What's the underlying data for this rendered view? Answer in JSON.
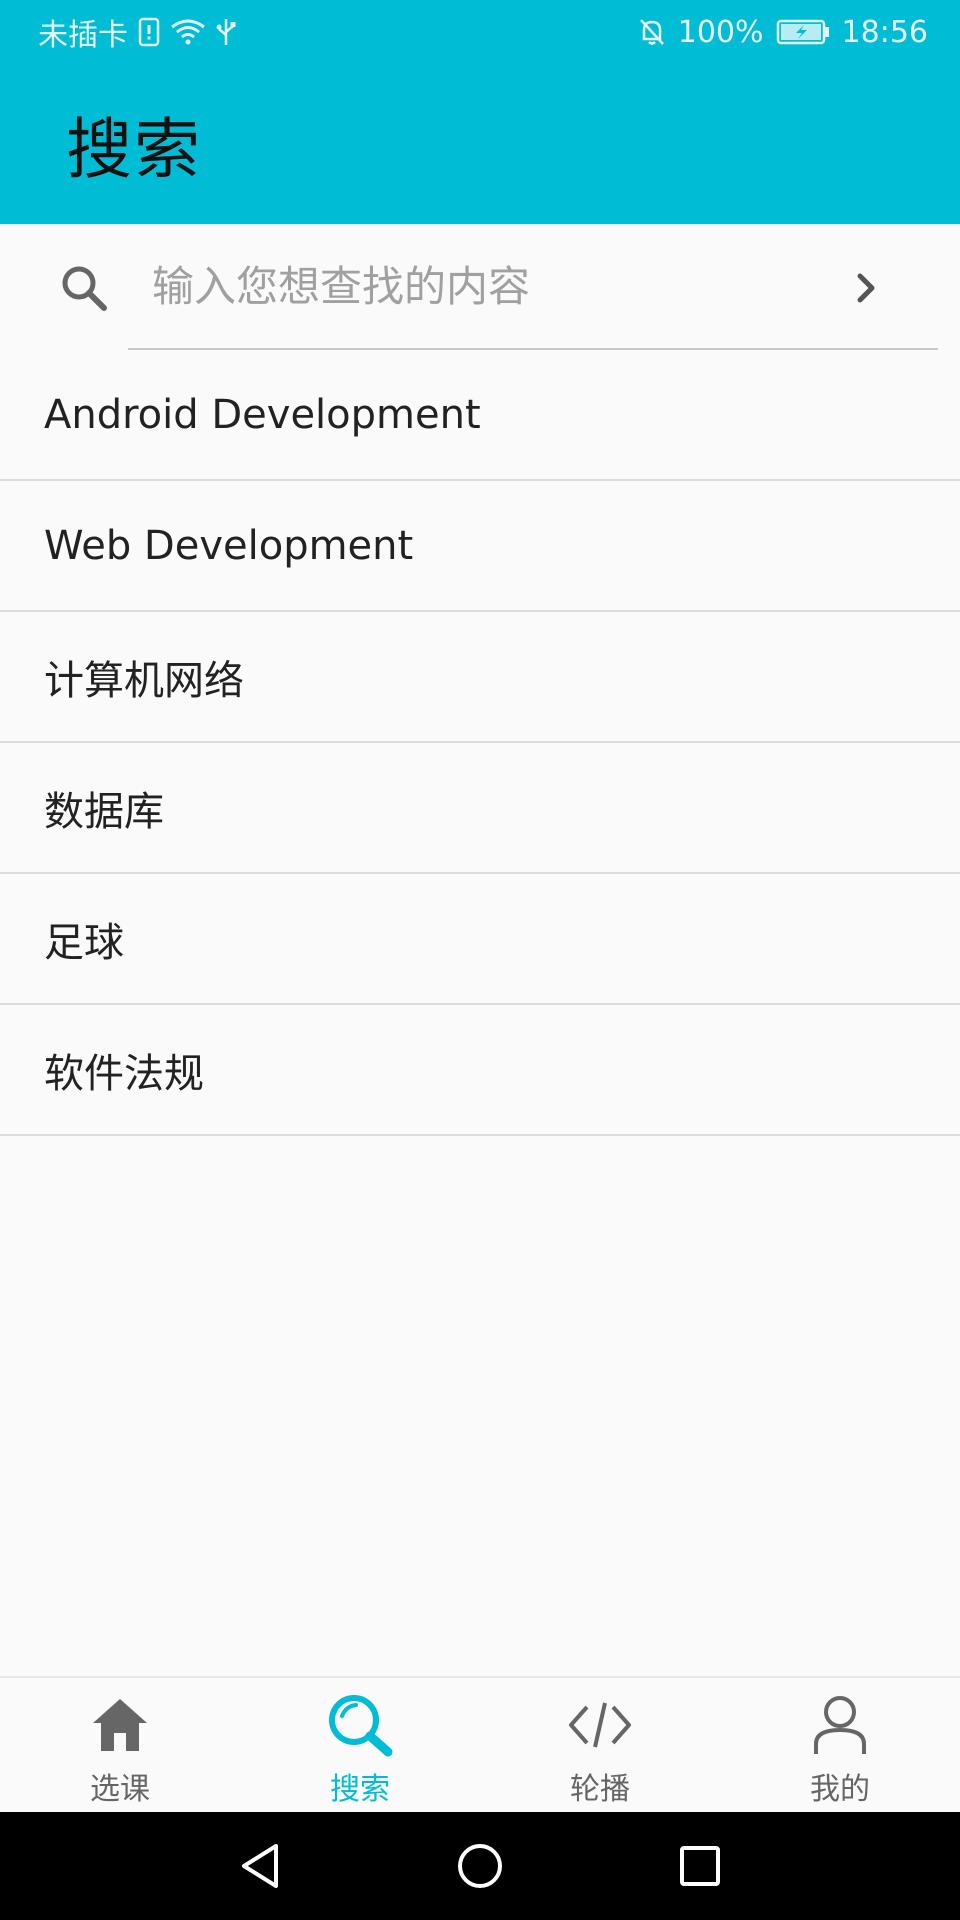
{
  "status_bar": {
    "carrier": "未插卡",
    "battery_percent": "100%",
    "time": "18:56",
    "icons": [
      "sim-icon",
      "wifi-icon",
      "usb-icon",
      "bell-off-icon",
      "battery-charging-icon"
    ]
  },
  "app_bar": {
    "title": "搜索"
  },
  "search": {
    "placeholder": "输入您想查找的内容",
    "value": ""
  },
  "topics": [
    {
      "label": "Android Development"
    },
    {
      "label": "Web Development"
    },
    {
      "label": "计算机网络"
    },
    {
      "label": "数据库"
    },
    {
      "label": "足球"
    },
    {
      "label": "软件法规"
    }
  ],
  "bottom_nav": {
    "items": [
      {
        "label": "选课",
        "icon": "home-icon",
        "active": false
      },
      {
        "label": "搜索",
        "icon": "search-icon",
        "active": true
      },
      {
        "label": "轮播",
        "icon": "code-icon",
        "active": false
      },
      {
        "label": "我的",
        "icon": "person-icon",
        "active": false
      }
    ]
  },
  "colors": {
    "primary": "#00bcd4",
    "text": "#222222",
    "hint": "#a0a0a0",
    "nav_inactive": "#666666"
  }
}
